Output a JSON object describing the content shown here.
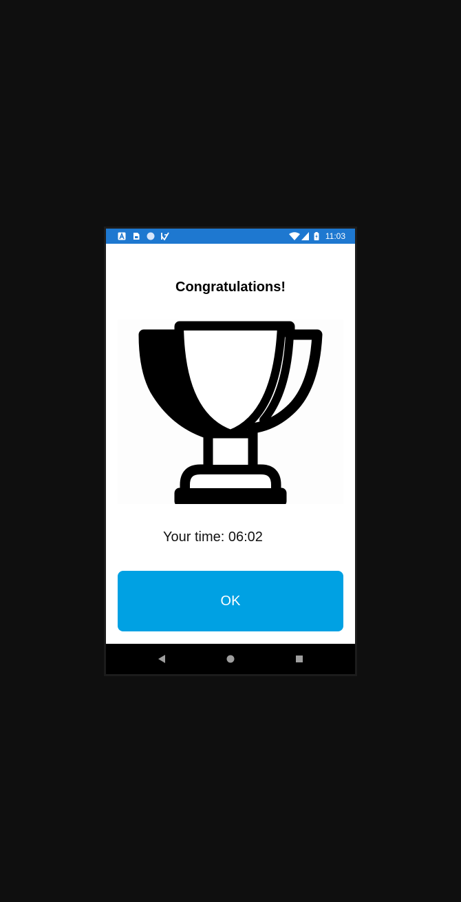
{
  "status_bar": {
    "time": "11:03",
    "left_icons": [
      "a-badge-icon",
      "sim-card-icon",
      "circle-icon",
      "check-flag-icon"
    ],
    "right_icons": [
      "wifi-icon",
      "cellular-signal-icon",
      "battery-charging-icon"
    ],
    "background_color": "#1e78d0"
  },
  "dialog": {
    "title": "Congratulations!",
    "image_icon": "trophy-icon",
    "time_label": "Your time:",
    "time_value": "06:02",
    "ok_label": "OK",
    "button_color": "#00a1e3"
  },
  "nav_bar": {
    "buttons": [
      "back-icon",
      "home-icon",
      "recents-icon"
    ]
  }
}
